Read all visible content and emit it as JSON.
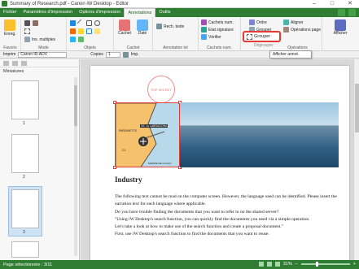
{
  "window": {
    "title": "Summary of Research.pdf - Canon iW Desktop - Editor",
    "controls": [
      "–",
      "□",
      "✕"
    ]
  },
  "tabs": [
    {
      "label": "Fichier",
      "active": false
    },
    {
      "label": "Paramètres d'impression",
      "active": false
    },
    {
      "label": "Options d'impression",
      "active": false
    },
    {
      "label": "Annotations",
      "active": true
    },
    {
      "label": "Outils",
      "active": false
    }
  ],
  "ribbon": {
    "favorites": {
      "button": "Enreg.",
      "group": "Favoris"
    },
    "mode": {
      "multi": "Ins. multiples",
      "group": "Mode"
    },
    "objects": {
      "group": "Objets"
    },
    "cachet": {
      "cachet": "Cachet",
      "date": "Date",
      "group": "Cachet"
    },
    "annotation_text": {
      "search": "Rech. texte",
      "group": "Annotation txt"
    },
    "stamps": {
      "num": "Cachets num.",
      "signature": "Etat signature",
      "verify": "Vérifier",
      "group": "Cachets num."
    },
    "arrange": {
      "order": "Ordre",
      "group_btn": "Grouper",
      "align": "Aligner",
      "page_ops": "Opérations page",
      "group": "Opérations"
    },
    "display": {
      "button": "Afficher"
    }
  },
  "grouper_dropdown": {
    "item": "Grouper",
    "sub": "Dégrouper"
  },
  "tooltip": "Afficher annot.",
  "toolbar": {
    "print_label": "Imprim",
    "printer": "Canon iR-ADV",
    "copies_label": "Copies",
    "copies_value": "1",
    "imp_label": "Imp."
  },
  "left_panel": {
    "title": "Miniatures",
    "pages": [
      "1",
      "2",
      "3"
    ],
    "selected": "3"
  },
  "document": {
    "stamp_text": "TOP SECRET",
    "map_labels": [
      "LA CASERNE",
      "DE LA LABRADORA",
      "PARDINETTE",
      "MARINE DE CLOLIO",
      "C1"
    ],
    "heading": "Industry",
    "paragraphs": [
      "The following text cannot be read on the computer screen. However, the language used can be identified. Please insert the narration text for each language where applicable.",
      "Do you have trouble finding the documents that you want to refer to on the shared server?",
      "\"Using iW Desktop's search function, you can quickly find the documents you need via a simple operation.",
      "Let's take a look at how to make use of the search function and create a proposal document.\"",
      "First, use iW Desktop's search function to find the documents that you want to reuse."
    ]
  },
  "status": {
    "left": "Page sélectionnée : 3/11",
    "zoom": "31%"
  },
  "colors": {
    "accent": "#2e7d32",
    "highlight": "#e53935"
  }
}
